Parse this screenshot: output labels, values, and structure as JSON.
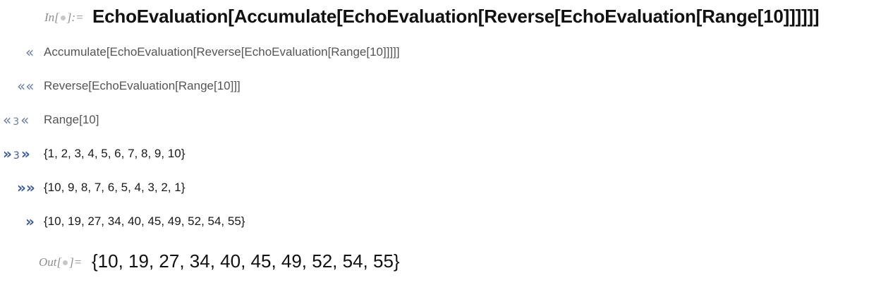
{
  "input": {
    "label_prefix": "In[",
    "label_suffix": "]:=",
    "expression": "EchoEvaluation[Accumulate[EchoEvaluation[Reverse[EchoEvaluation[Range[10]]]]]]"
  },
  "echo_lines": [
    {
      "marker": "«",
      "level": "",
      "text": "Accumulate[EchoEvaluation[Reverse[EchoEvaluation[Range[10]]]]]"
    },
    {
      "marker": "««",
      "level": "",
      "text": "Reverse[EchoEvaluation[Range[10]]]"
    },
    {
      "marker_left": "«",
      "level": "3",
      "marker_right": "«",
      "text": "Range[10]"
    },
    {
      "marker_left": "»",
      "level": "3",
      "marker_right": "»",
      "text": "{1, 2, 3, 4, 5, 6, 7, 8, 9, 10}"
    },
    {
      "marker": "»»",
      "level": "",
      "text": "{10, 9, 8, 7, 6, 5, 4, 3, 2, 1}"
    },
    {
      "marker": "»",
      "level": "",
      "text": "{10, 19, 27, 34, 40, 45, 49, 52, 54, 55}"
    }
  ],
  "output": {
    "label_prefix": "Out[",
    "label_suffix": "]=",
    "expression": "{10, 19, 27, 34, 40, 45, 49, 52, 54, 55}"
  },
  "colors": {
    "label": "#8e8e8e",
    "echo_marker": "#6a7da8",
    "echo_expr": "#555555",
    "text": "#111111"
  }
}
